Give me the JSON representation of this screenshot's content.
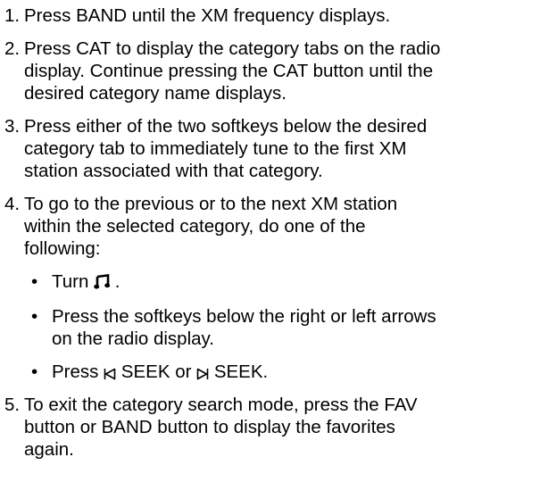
{
  "steps": [
    {
      "number": "1.",
      "text": "Press BAND until the XM frequency displays."
    },
    {
      "number": "2.",
      "text": "Press CAT to display the category tabs on the radio\ndisplay. Continue pressing the CAT button until the\ndesired category name displays."
    },
    {
      "number": "3.",
      "text": "Press either of the two softkeys below the desired\ncategory tab to immediately tune to the first XM\nstation associated with that category."
    },
    {
      "number": "4.",
      "text": "To go to the previous or to the next XM station\nwithin the selected category, do one of the\nfollowing:"
    },
    {
      "number": "5.",
      "text": "To exit the category search mode, press the FAV\nbutton or BAND button to display the favorites\nagain."
    }
  ],
  "bullets": {
    "marker": "•",
    "turn": {
      "before": "Turn ",
      "icon": "music-note-knob-icon",
      "after": " ."
    },
    "softkeys": "Press the softkeys below the right or left arrows\non the radio display.",
    "seek": {
      "prefix": "Press ",
      "back_icon": "seek-back-icon",
      "middle": " SEEK or ",
      "fwd_icon": "seek-forward-icon",
      "suffix": " SEEK."
    }
  }
}
